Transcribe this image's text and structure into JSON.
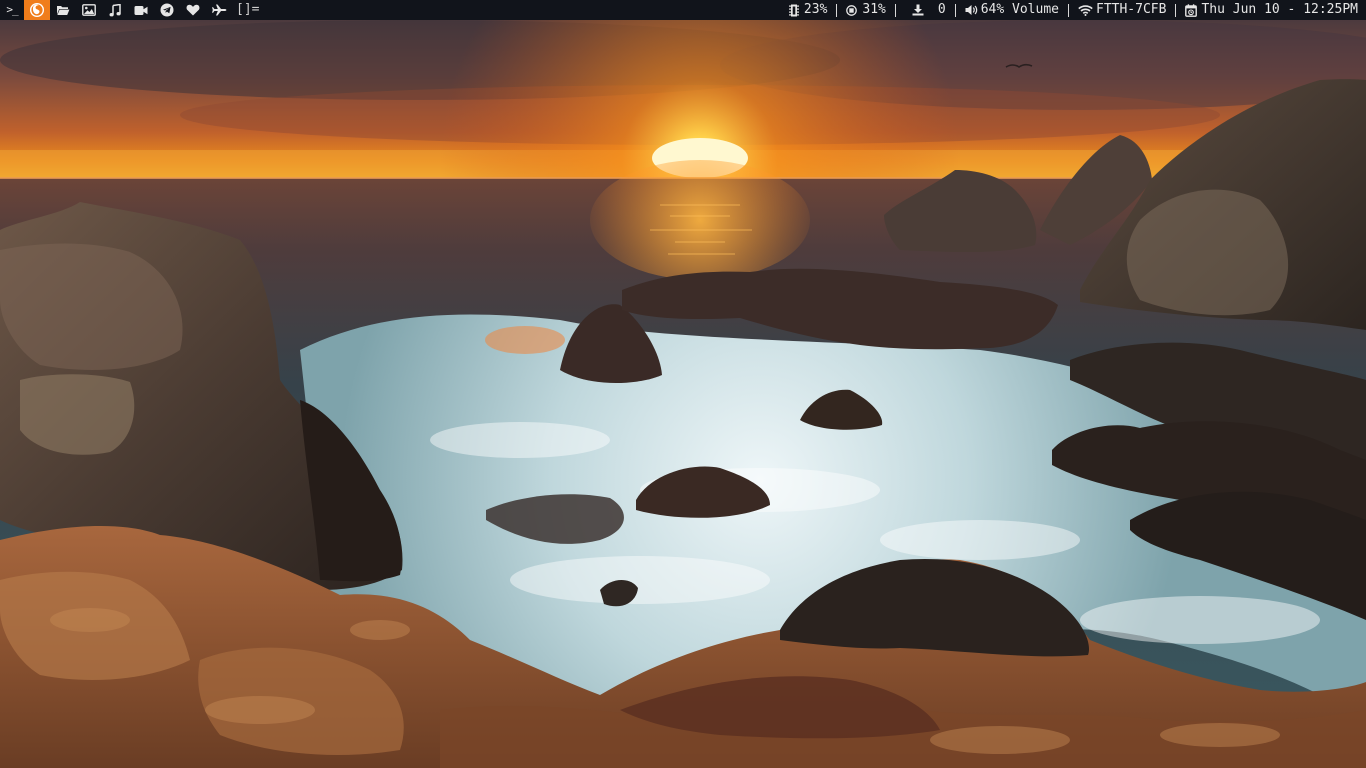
{
  "topbar": {
    "terminal_glyph": ">_",
    "layout_indicator": "[]=",
    "launchers": [
      {
        "name": "file-manager",
        "icon": "folder-open-icon"
      },
      {
        "name": "image-viewer",
        "icon": "image-icon"
      },
      {
        "name": "music-player",
        "icon": "music-note-icon"
      },
      {
        "name": "video-player",
        "icon": "video-camera-icon"
      },
      {
        "name": "telegram",
        "icon": "telegram-icon"
      },
      {
        "name": "favorites",
        "icon": "heart-icon"
      },
      {
        "name": "flight",
        "icon": "airplane-icon"
      }
    ],
    "status": {
      "memory": "23%",
      "cpu": "31%",
      "downloads": "0",
      "volume": "64% Volume",
      "wifi": "FTTH-7CFB",
      "clock": "Thu Jun 10 - 12:25PM"
    }
  },
  "colors": {
    "bar_bg": "#11141b",
    "accent": "#f07d1b",
    "bar_text": "#e6e6e6"
  }
}
